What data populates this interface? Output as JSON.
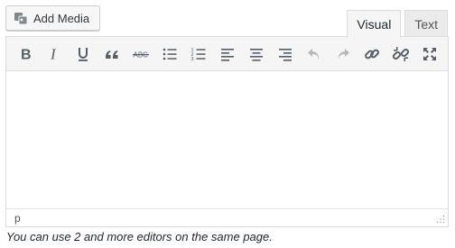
{
  "add_media": {
    "label": "Add Media",
    "icon": "media-icon"
  },
  "tabs": [
    {
      "label": "Visual",
      "active": true
    },
    {
      "label": "Text",
      "active": false
    }
  ],
  "toolbar": {
    "buttons": [
      {
        "name": "bold",
        "icon": "bold-icon"
      },
      {
        "name": "italic",
        "icon": "italic-icon"
      },
      {
        "name": "underline",
        "icon": "underline-icon"
      },
      {
        "name": "blockquote",
        "icon": "blockquote-icon"
      },
      {
        "name": "strikethrough",
        "icon": "strikethrough-icon",
        "glyph": "ABC"
      },
      {
        "name": "bulleted-list",
        "icon": "bulleted-list-icon"
      },
      {
        "name": "numbered-list",
        "icon": "numbered-list-icon"
      },
      {
        "name": "align-left",
        "icon": "align-left-icon"
      },
      {
        "name": "align-center",
        "icon": "align-center-icon"
      },
      {
        "name": "align-right",
        "icon": "align-right-icon"
      },
      {
        "name": "undo",
        "icon": "undo-icon",
        "disabled": true
      },
      {
        "name": "redo",
        "icon": "redo-icon",
        "disabled": true
      },
      {
        "name": "insert-link",
        "icon": "link-icon"
      },
      {
        "name": "remove-link",
        "icon": "unlink-icon"
      },
      {
        "name": "fullscreen",
        "icon": "fullscreen-icon"
      }
    ]
  },
  "statusbar": {
    "path": "p"
  },
  "caption": "You can use 2 and more editors on the same page.",
  "colors": {
    "toolbar_bg": "#f5f5f5",
    "border": "#dcdcdc",
    "icon": "#555d66",
    "disabled_icon": "#b4b9be"
  }
}
